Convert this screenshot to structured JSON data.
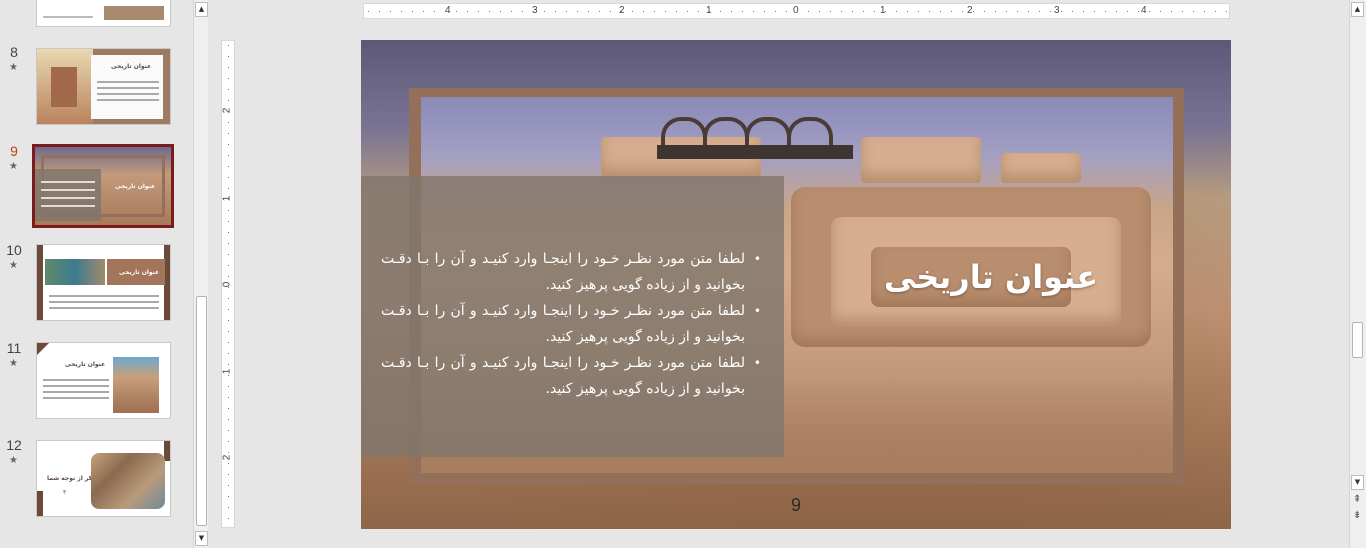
{
  "thumbnails": [
    {
      "number": "8",
      "title": "عنوان تاریخی"
    },
    {
      "number": "9",
      "title": "عنوان تاریخی"
    },
    {
      "number": "10",
      "title": "عنوان تاریخی"
    },
    {
      "number": "11",
      "title": "عنوان تاریخی"
    },
    {
      "number": "12",
      "title": "با تشکر از توجه شما",
      "sub": "۳"
    }
  ],
  "star": "★",
  "scroll": {
    "up": "▲",
    "down": "▼"
  },
  "ruler": {
    "h": [
      "4",
      "3",
      "2",
      "1",
      "0",
      "1",
      "2",
      "3",
      "4"
    ],
    "v": [
      "2",
      "1",
      "0",
      "1",
      "2"
    ]
  },
  "slide": {
    "title": "عنوان تاریخی",
    "bullets": [
      "لطفا متن مورد نظـر خـود را اینجـا وارد کنیـد و آن را بـا دقـت بخوانید و از زیاده گویی پرهیز کنید.",
      "لطفا متن مورد نظـر خـود را اینجـا وارد کنیـد و آن را بـا دقـت بخوانید و از زیاده گویی پرهیز کنید.",
      "لطفا متن مورد نظـر خـود را اینجـا وارد کنیـد و آن را بـا دقـت بخوانید و از زیاده گویی پرهیز کنید."
    ],
    "number": "9"
  },
  "nav": {
    "prev": "⇞",
    "next": "⇟"
  }
}
